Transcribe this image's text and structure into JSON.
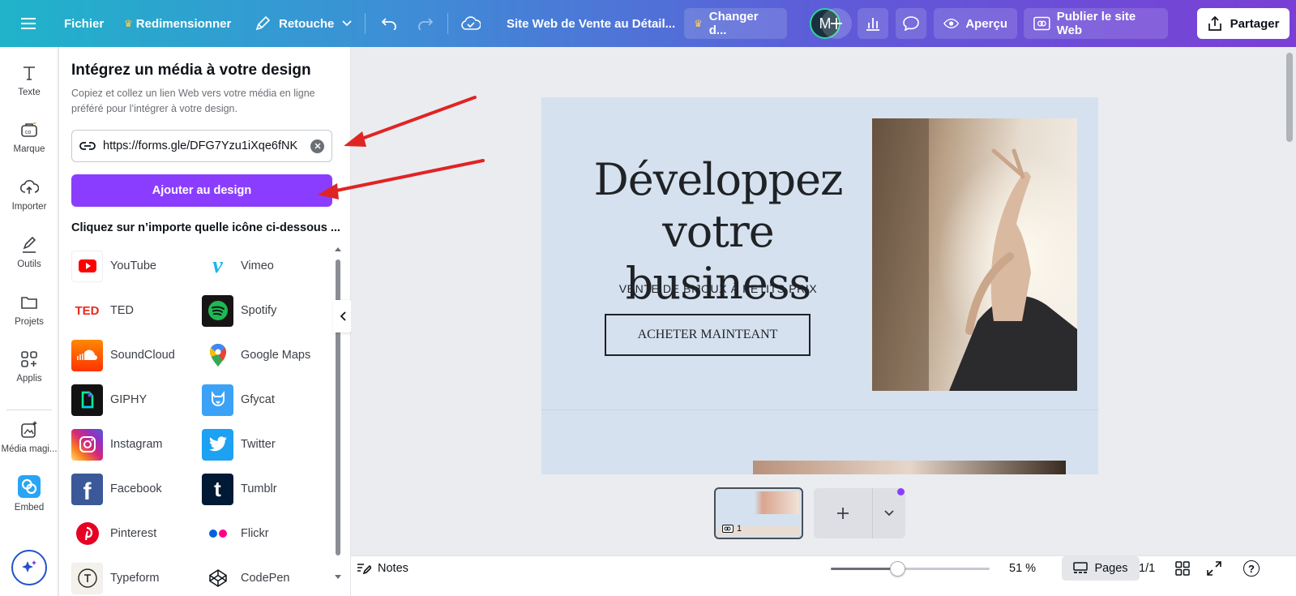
{
  "topbar": {
    "file": "Fichier",
    "resize": "Redimensionner",
    "retouch": "Retouche",
    "doc_title": "Site Web de Vente au Détail...",
    "upgrade": "Changer d...",
    "avatar_letter": "M",
    "preview": "Aperçu",
    "publish": "Publier le site Web",
    "share": "Partager"
  },
  "rail": {
    "items": [
      {
        "label": "Texte"
      },
      {
        "label": "Marque"
      },
      {
        "label": "Importer"
      },
      {
        "label": "Outils"
      },
      {
        "label": "Projets"
      },
      {
        "label": "Applis"
      },
      {
        "label": "Média magi..."
      },
      {
        "label": "Embed"
      }
    ]
  },
  "panel": {
    "title": "Intégrez un média à votre design",
    "description": "Copiez et collez un lien Web vers votre média en ligne préféré pour l’intégrer à votre design.",
    "url_value": "https://forms.gle/DFG7Yzu1iXqe6fNK",
    "add_button": "Ajouter au design",
    "hint": "Cliquez sur n’importe quelle icône ci-dessous ...",
    "services_left": [
      "YouTube",
      "TED",
      "SoundCloud",
      "GIPHY",
      "Instagram",
      "Facebook",
      "Pinterest",
      "Typeform"
    ],
    "services_right": [
      "Vimeo",
      "Spotify",
      "Google Maps",
      "Gfycat",
      "Twitter",
      "Tumblr",
      "Flickr",
      "CodePen"
    ]
  },
  "canvas": {
    "headline_line1": "Développez",
    "headline_line2": "votre business",
    "subline": "VENTE DE BIJOUX À PETITS PRIX",
    "cta": "ACHETER MAINTEANT",
    "thumb_page_number": "1"
  },
  "bottombar": {
    "notes": "Notes",
    "zoom": "51 %",
    "zoom_level": 0.42,
    "pages": "Pages",
    "page_count": "1/1",
    "help": "?"
  },
  "colors": {
    "accent": "#8b3dff",
    "page_background": "#d5e1ee",
    "annotation_arrow": "#e02424"
  }
}
